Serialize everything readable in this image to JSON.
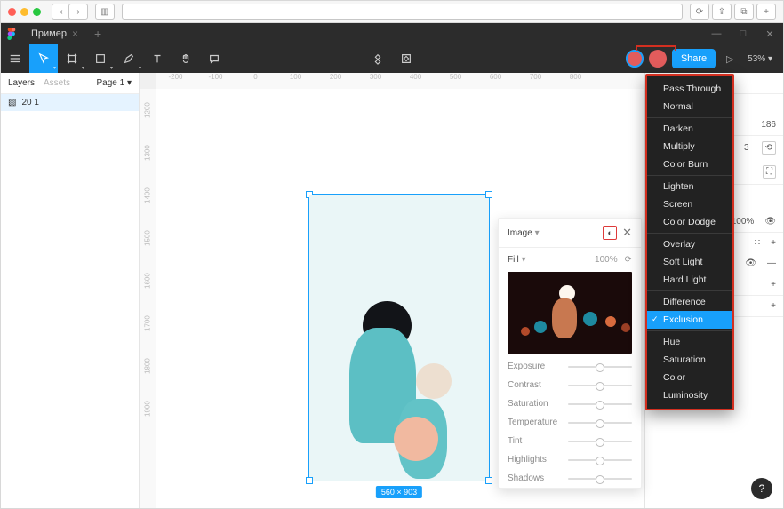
{
  "mac": {
    "nav_back": "‹",
    "nav_fwd": "›",
    "reload": "⟳",
    "share": "⇪",
    "tabs": "⧉",
    "plus": "+"
  },
  "fig_title": {
    "tab_name": "Пример",
    "close": "×",
    "new_tab": "+",
    "min": "—",
    "max": "□",
    "cls": "✕"
  },
  "toolbar": {
    "share": "Share",
    "zoom": "53%",
    "play": "▷",
    "chev": "▾"
  },
  "left": {
    "layers": "Layers",
    "assets": "Assets",
    "page": "Page 1",
    "layer_name": "20 1"
  },
  "ruler_h": [
    "-200",
    "-100",
    "0",
    "100",
    "200",
    "300",
    "400",
    "500",
    "600",
    "700",
    "800"
  ],
  "ruler_v": [
    "1200",
    "1300",
    "1400",
    "1500",
    "1600",
    "1700",
    "1800",
    "1900"
  ],
  "sel_badge": "560 × 903",
  "right": {
    "val1": "186",
    "val2": "3",
    "pct": "100%"
  },
  "popover": {
    "title": "Image",
    "chev": "▾",
    "fill": "Fill",
    "pct": "100%",
    "sliders": [
      "Exposure",
      "Contrast",
      "Saturation",
      "Temperature",
      "Tint",
      "Highlights",
      "Shadows"
    ]
  },
  "blend_modes": {
    "groups": [
      [
        "Pass Through",
        "Normal"
      ],
      [
        "Darken",
        "Multiply",
        "Color Burn"
      ],
      [
        "Lighten",
        "Screen",
        "Color Dodge"
      ],
      [
        "Overlay",
        "Soft Light",
        "Hard Light"
      ],
      [
        "Difference",
        "Exclusion"
      ],
      [
        "Hue",
        "Saturation",
        "Color",
        "Luminosity"
      ]
    ],
    "selected": "Exclusion"
  },
  "help": "?"
}
